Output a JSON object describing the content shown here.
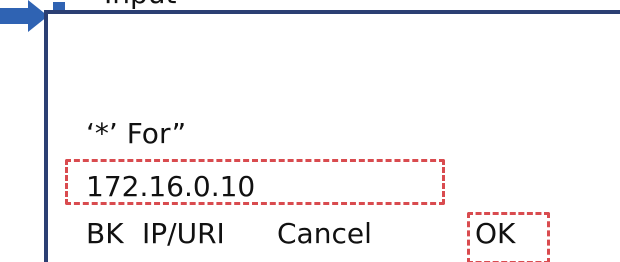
{
  "top_partial_text": "Input",
  "display": {
    "prompt": "‘*’ For”",
    "value": "172.16.0.10"
  },
  "softkeys": [
    {
      "label": "BK"
    },
    {
      "label": "IP/URI"
    },
    {
      "label": "Cancel"
    },
    {
      "label": "OK"
    }
  ],
  "colors": {
    "frame": "#2b3f73",
    "arrow": "#2f63b3",
    "highlight": "#d94b4f"
  },
  "icons": {
    "left_arrow": "arrow-right-icon",
    "right_arrow": "arrow-right-icon"
  }
}
